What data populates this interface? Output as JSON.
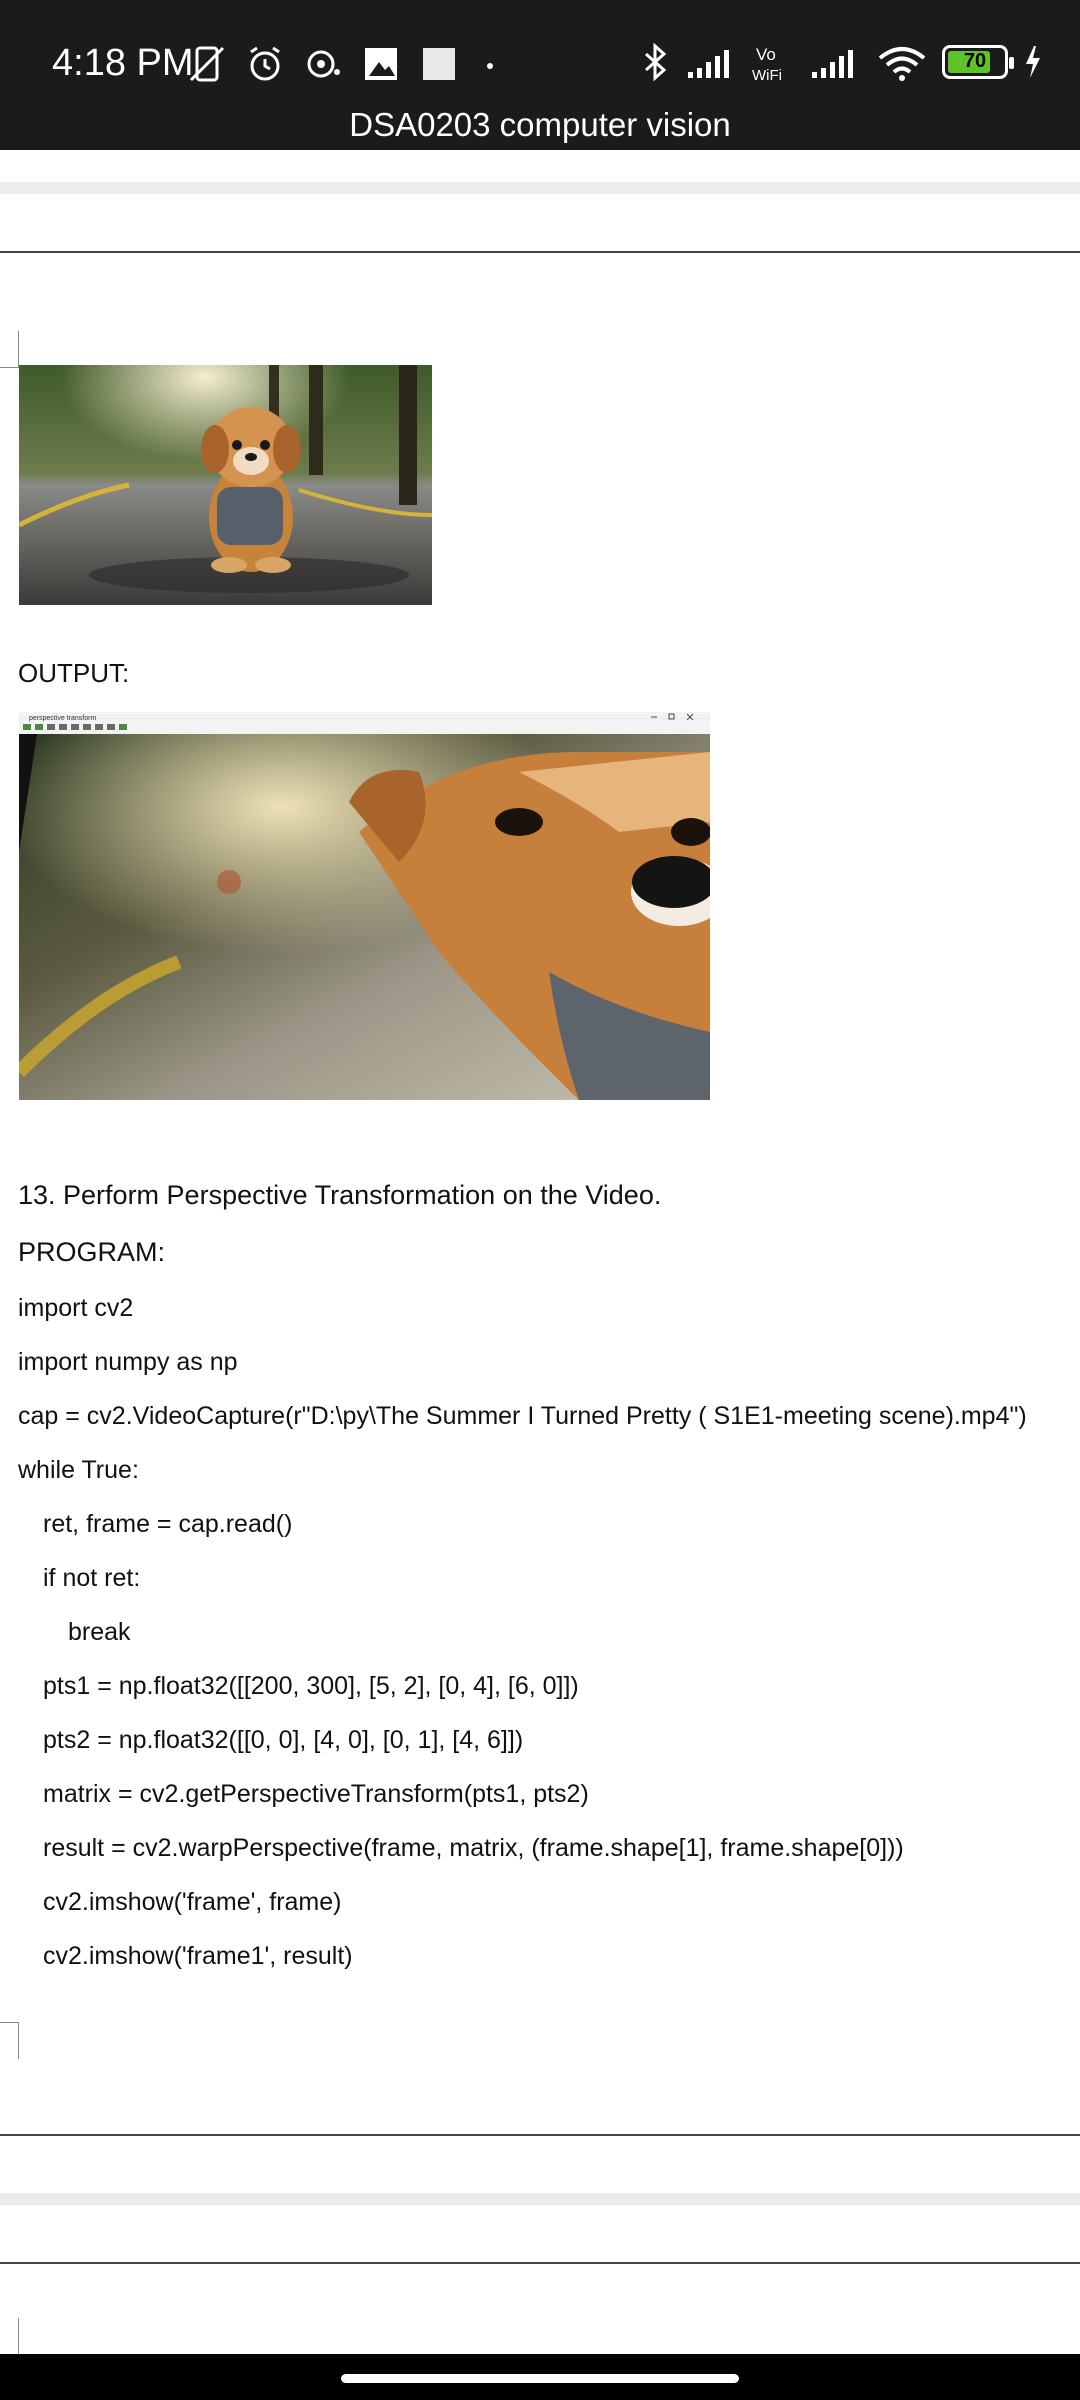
{
  "status_bar": {
    "time": "4:18 PM",
    "battery": "70",
    "vowifi_label_top": "Vo",
    "vowifi_label_bottom": "WiFi"
  },
  "document": {
    "title": "DSA0203 computer vision",
    "output_label": "OUTPUT:",
    "question": "13. Perform Perspective Transformation on the Video.",
    "program_label": "PROGRAM:",
    "code_lines": [
      "import cv2",
      "import numpy as np",
      "cap = cv2.VideoCapture(r\"D:\\py\\The Summer I Turned Pretty ( S1E1-meeting scene).mp4\")",
      "while True:",
      "ret, frame = cap.read()",
      "if not ret:",
      "break",
      "pts1 = np.float32([[200, 300], [5, 2], [0, 4], [6, 0]])",
      "pts2 = np.float32([[0, 0], [4, 0], [0, 1], [4, 6]])",
      "matrix = cv2.getPerspectiveTransform(pts1, pts2)",
      "result = cv2.warpPerspective(frame, matrix, (frame.shape[1], frame.shape[0]))",
      "cv2.imshow('frame', frame)",
      "cv2.imshow('frame1', result)"
    ],
    "output_window_title": "perspective transform"
  }
}
